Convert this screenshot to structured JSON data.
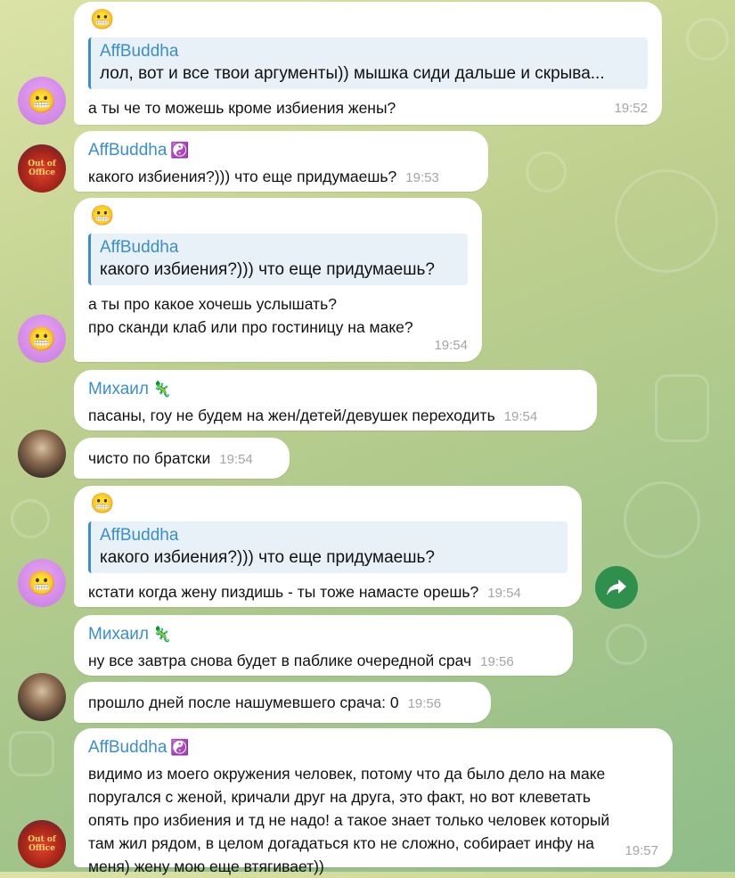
{
  "messages": [
    {
      "emoji": "😬",
      "quote_name": "AffBuddha",
      "quote_text": "лол, вот и все твои аргументы)) мышка сиди дальше и скрыва...",
      "text": "а ты че то можешь кроме избиения жены?",
      "time": "19:52"
    },
    {
      "sender": "AffBuddha",
      "badge": "☯️",
      "text": "какого избиения?))) что еще придумаешь?",
      "time": "19:53",
      "avatar_text": "Out of Office"
    },
    {
      "emoji": "😬",
      "quote_name": "AffBuddha",
      "quote_text": "какого избиения?))) что еще придумаешь?",
      "line1": "а ты про какое хочешь услышать?",
      "line2": "про сканди клаб или про гостиницу на маке?",
      "time": "19:54"
    },
    {
      "sender": "Михаил",
      "badge": "🦎",
      "text": "пасаны, гоу не будем на жен/детей/девушек переходить",
      "time": "19:54"
    },
    {
      "text": "чисто по братски",
      "time": "19:54"
    },
    {
      "emoji": "😬",
      "quote_name": "AffBuddha",
      "quote_text": "какого избиения?))) что еще придумаешь?",
      "text": "кстати когда жену пиздишь - ты тоже намасте орешь?",
      "time": "19:54"
    },
    {
      "sender": "Михаил",
      "badge": "🦎",
      "text": "ну все завтра снова будет в паблике очередной срач",
      "time": "19:56"
    },
    {
      "text": "прошло дней после нашумевшего срача: 0",
      "time": "19:56"
    },
    {
      "sender": "AffBuddha",
      "badge": "☯️",
      "l1": "видимо из моего окружения человек, потому что да было дело на маке",
      "l2": "поругался с женой, кричали друг на друга, это факт, но вот клеветать",
      "l3": "опять про избиения и тд не надо! а такое знает только человек который",
      "l4": "там жил рядом, в целом догадаться кто не сложно, собирает инфу на",
      "l5": "меня) жену мою еще втягивает))",
      "time": "19:57",
      "avatar_text": "Out of Office"
    }
  ],
  "icons": {
    "share": "share-arrow-icon"
  }
}
